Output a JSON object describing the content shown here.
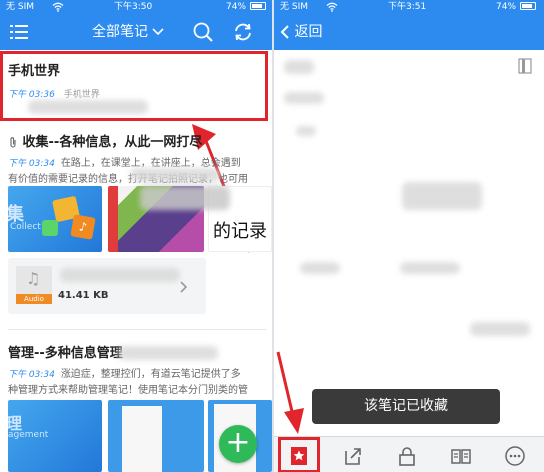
{
  "left_screen": {
    "status": {
      "carrier": "无 SIM",
      "time": "下午3:50",
      "battery": "74%"
    },
    "navbar": {
      "title": "全部笔记"
    },
    "notes": [
      {
        "title": "手机世界",
        "time": "下午 03:36",
        "notebook": "手机世界"
      },
      {
        "title": "收集--各种信息，从此一网打尽",
        "time": "下午 03:34",
        "text_line1": "在路上，在课堂上，在讲座上，总会遇到",
        "text_line2": "有价值的需要记录的信息，打开笔记拍照记录，也可用",
        "thumb2_text": "的记录"
      },
      {
        "attachment_badge": "Audio",
        "attachment_size": "41.41 KB"
      },
      {
        "title": "管理--多种信息管理",
        "time": "下午 03:34",
        "text_line1": "涨迫症，整理控们，有道云笔记提供了多",
        "text_line2": "种管理方式来帮助管理笔记！使用笔记本分门别类的管",
        "thumb_label": "agement"
      }
    ],
    "thumb1_label": "Collect",
    "fab_label": "+"
  },
  "right_screen": {
    "status": {
      "carrier": "无 SIM",
      "time": "下午3:51",
      "battery": "74%"
    },
    "navbar": {
      "back_label": "返回"
    },
    "toast": "该笔记已收藏"
  },
  "colors": {
    "accent": "#2d8bf0",
    "highlight": "#e0262c",
    "fab": "#2fba5a"
  }
}
